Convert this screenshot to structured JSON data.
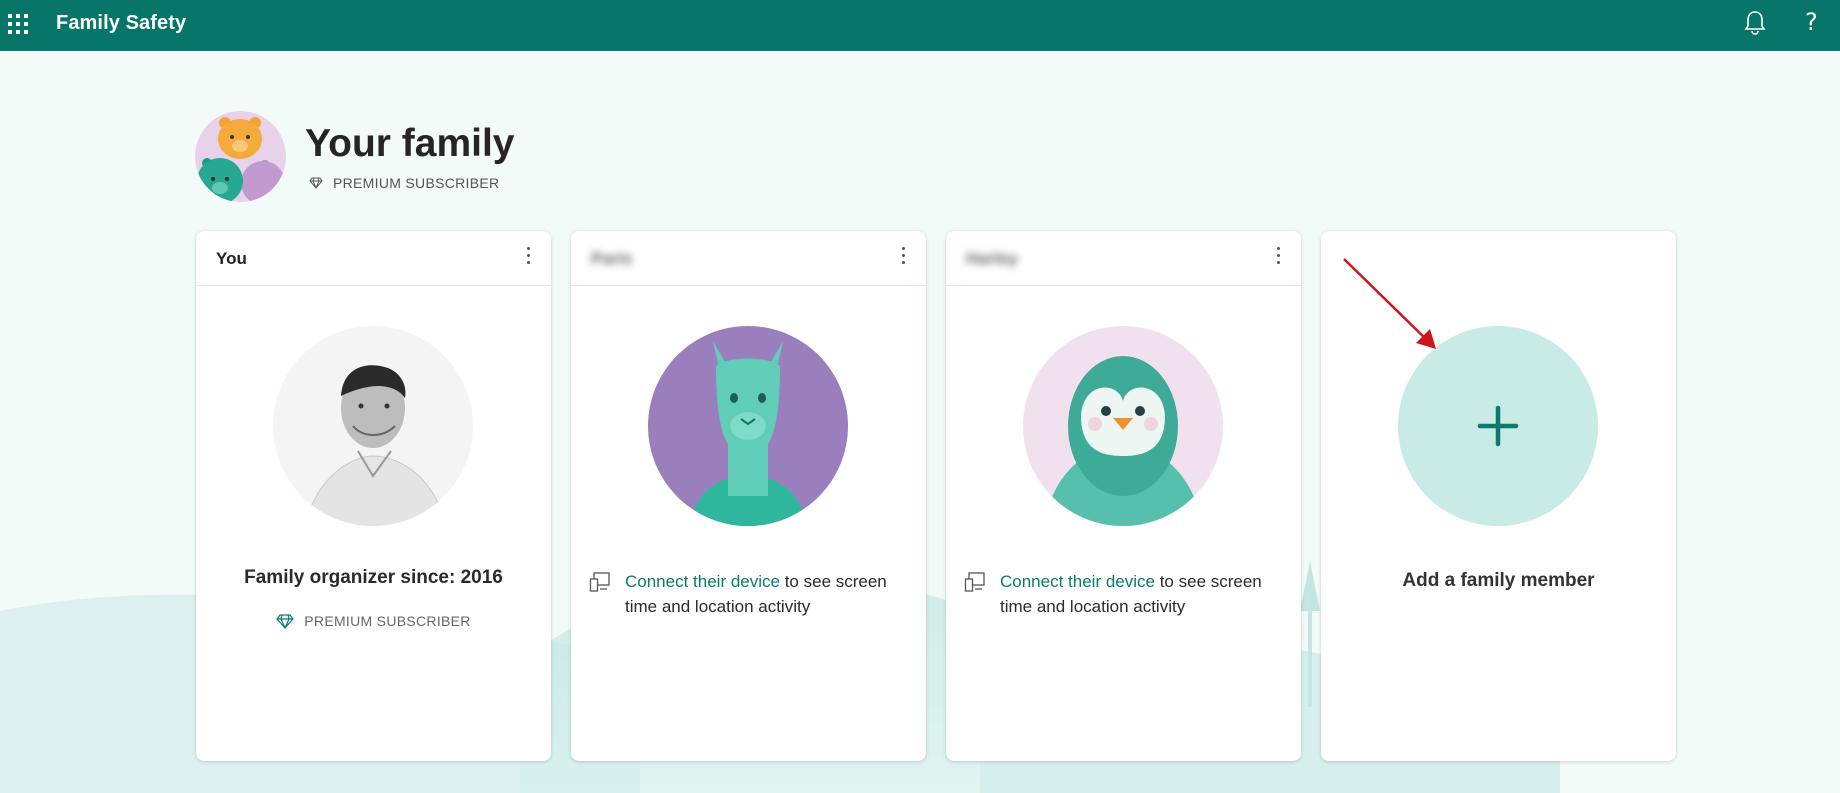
{
  "app": {
    "title": "Family Safety"
  },
  "topbar": {
    "waffle_icon": "app-launcher-icon",
    "bell_icon": "bell-icon",
    "help_icon": "?"
  },
  "header": {
    "title": "Your family",
    "badge": "PREMIUM SUBSCRIBER"
  },
  "colors": {
    "brand": "#077568",
    "link": "#0a7a6b",
    "add_circle": "#c8ebe5",
    "arrow": "#d0141a"
  },
  "cards": [
    {
      "name": "You",
      "status": "Family organizer since: 2016",
      "badge": "PREMIUM SUBSCRIBER",
      "avatar": "person-photo"
    },
    {
      "name": "Paris",
      "link_text": "Connect their device",
      "rest_text": " to see screen time and location activity",
      "avatar": "llama-avatar"
    },
    {
      "name": "Harley",
      "link_text": "Connect their device",
      "rest_text": " to see screen time and location activity",
      "avatar": "penguin-avatar"
    },
    {
      "add_label": "Add a family member",
      "add_icon": "+"
    }
  ]
}
